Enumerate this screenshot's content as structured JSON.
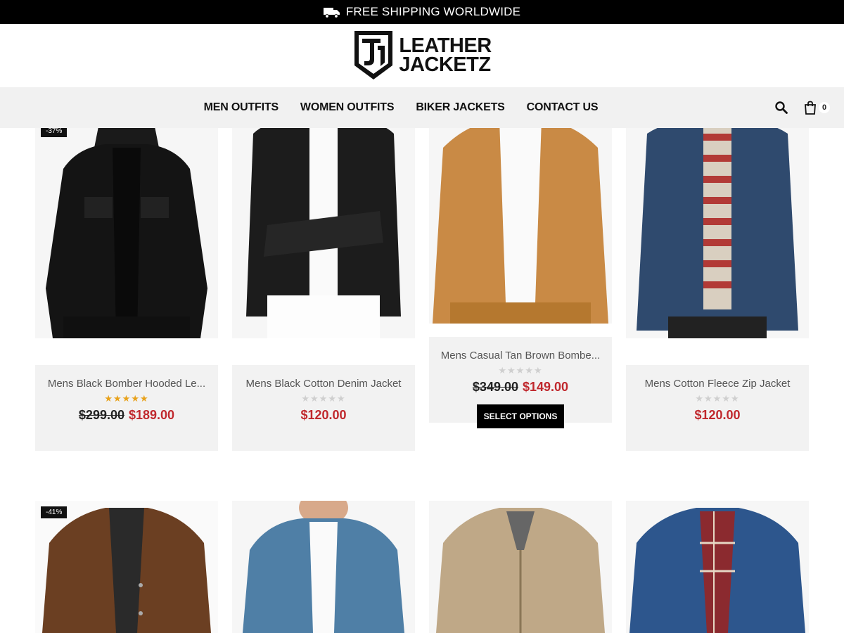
{
  "topbar": {
    "text": "FREE SHIPPING WORLDWIDE",
    "icon": "truck-icon"
  },
  "logo": {
    "line1": "LEATHER",
    "line2": "JACKETZ"
  },
  "nav": {
    "items": [
      "MEN OUTFITS",
      "WOMEN OUTFITS",
      "BIKER JACKETS",
      "CONTACT US"
    ],
    "cart_count": "0"
  },
  "products": [
    {
      "name": "Mens Black Bomber Hooded Le...",
      "old_price": "$299.00",
      "price": "$189.00",
      "rating": 5,
      "badge": "-37%"
    },
    {
      "name": "Mens Black Cotton Denim Jacket",
      "old_price": "",
      "price": "$120.00",
      "rating": 0,
      "badge": ""
    },
    {
      "name": "Mens Casual Tan Brown Bombe...",
      "old_price": "$349.00",
      "price": "$149.00",
      "rating": 0,
      "badge": "",
      "button": "SELECT OPTIONS"
    },
    {
      "name": "Mens Cotton Fleece Zip Jacket",
      "old_price": "",
      "price": "$120.00",
      "rating": 0,
      "badge": ""
    }
  ],
  "row2_badge": "-41%",
  "colors": {
    "accent": "#c0282d",
    "topbar": "#000000",
    "nav_bg": "#f1f1f1",
    "star": "#e8a21b"
  }
}
